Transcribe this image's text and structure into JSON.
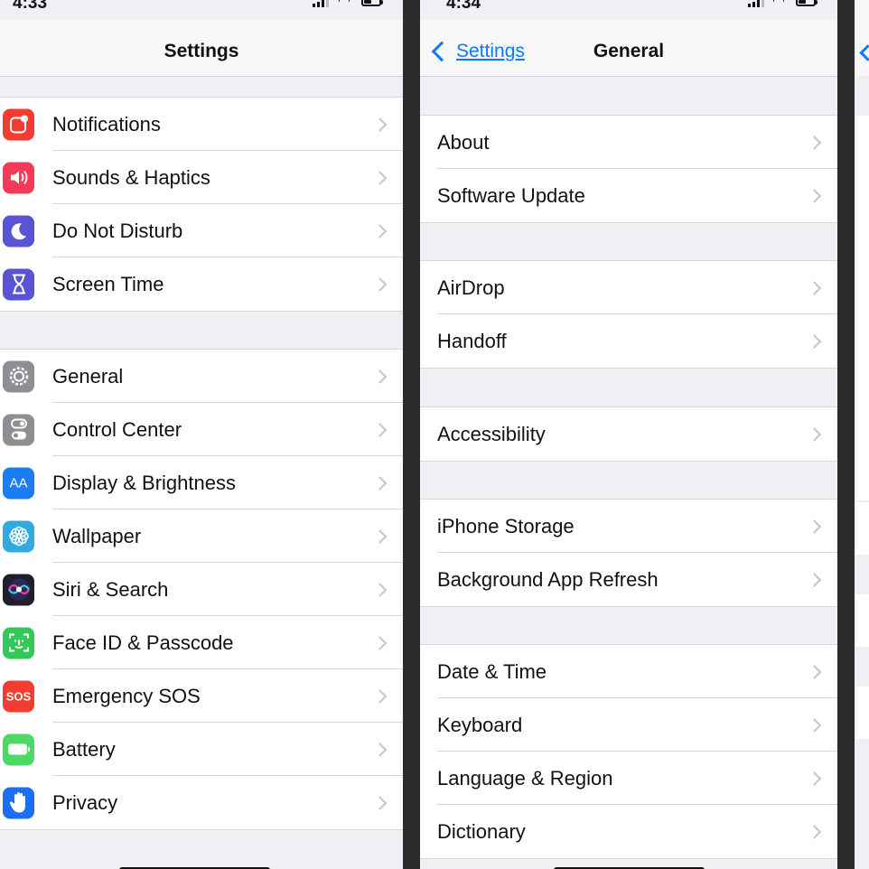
{
  "settings_screen": {
    "status": {
      "time": "4:33"
    },
    "nav_title": "Settings",
    "groups": [
      [
        {
          "label": "Notifications",
          "icon": "notifications-icon",
          "color": "#f33d32"
        },
        {
          "label": "Sounds & Haptics",
          "icon": "speaker-icon",
          "color": "#f33b59"
        },
        {
          "label": "Do Not Disturb",
          "icon": "moon-icon",
          "color": "#5a54d4"
        },
        {
          "label": "Screen Time",
          "icon": "hourglass-icon",
          "color": "#5a54d4"
        }
      ],
      [
        {
          "label": "General",
          "icon": "gear-icon",
          "color": "#8e8e93"
        },
        {
          "label": "Control Center",
          "icon": "toggles-icon",
          "color": "#8e8e93"
        },
        {
          "label": "Display & Brightness",
          "icon": "text-size-icon",
          "icon_text": "AA",
          "color": "#1a7df2"
        },
        {
          "label": "Wallpaper",
          "icon": "flower-icon",
          "color": "#34a9e0"
        },
        {
          "label": "Siri & Search",
          "icon": "siri-icon",
          "color": "#1f1f2e"
        },
        {
          "label": "Face ID & Passcode",
          "icon": "face-id-icon",
          "color": "#34c759"
        },
        {
          "label": "Emergency SOS",
          "icon": "sos-icon",
          "icon_text": "SOS",
          "color": "#f33d32"
        },
        {
          "label": "Battery",
          "icon": "battery-icon",
          "color": "#4cd964"
        },
        {
          "label": "Privacy",
          "icon": "hand-icon",
          "color": "#1a6ff2"
        }
      ]
    ]
  },
  "general_screen": {
    "status": {
      "time": "4:34"
    },
    "back_label": "Settings",
    "nav_title": "General",
    "groups": [
      [
        {
          "label": "About"
        },
        {
          "label": "Software Update"
        }
      ],
      [
        {
          "label": "AirDrop"
        },
        {
          "label": "Handoff"
        }
      ],
      [
        {
          "label": "Accessibility"
        }
      ],
      [
        {
          "label": "iPhone Storage"
        },
        {
          "label": "Background App Refresh"
        }
      ],
      [
        {
          "label": "Date & Time"
        },
        {
          "label": "Keyboard"
        },
        {
          "label": "Language & Region"
        },
        {
          "label": "Dictionary"
        }
      ]
    ]
  },
  "colors": {
    "accent": "#0a7aff",
    "background": "#efeff4",
    "divider": "#2b2b2b"
  }
}
